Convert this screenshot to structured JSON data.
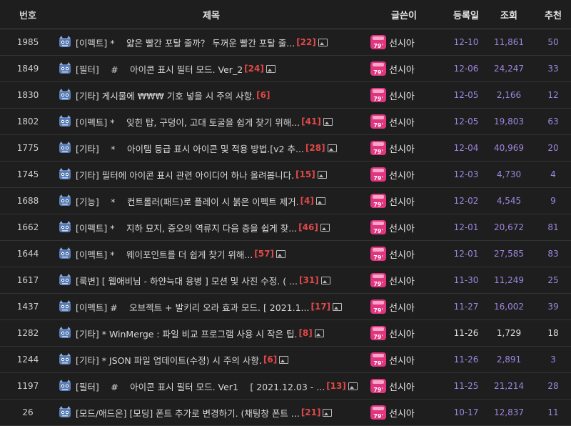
{
  "headers": {
    "no": "번호",
    "title": "제목",
    "writer": "글쓴이",
    "date": "등록일",
    "views": "조회",
    "rec": "추천"
  },
  "colors": {
    "date_purple": "#9d86e0",
    "comment_count": "#e04848",
    "badge": "#e0357f"
  },
  "badge_text": "79'",
  "rows": [
    {
      "no": "1985",
      "title": "[이펙트] * 　얇은 빨간 포탈 줄까？ 두꺼운 빨간 포탈 줄...",
      "comments": "[22]",
      "img": true,
      "writer": "선시아",
      "date": "12-10",
      "views": "11,861",
      "rec": "50",
      "date_style": "purple"
    },
    {
      "no": "1849",
      "title": "[필터] 　# 　아이콘 표시 필터 모드. Ver_2",
      "comments": "[24]",
      "img": true,
      "writer": "선시아",
      "date": "12-06",
      "views": "24,247",
      "rec": "33",
      "date_style": "purple"
    },
    {
      "no": "1830",
      "title": "[기타] 게시물에 ₩₩₩ 기호 넣을 시 주의 사항.",
      "comments": "[6]",
      "img": false,
      "writer": "선시아",
      "date": "12-05",
      "views": "2,166",
      "rec": "12",
      "date_style": "purple"
    },
    {
      "no": "1802",
      "title": "[이펙트] * 　잊힌 탑, 구덩이, 고대 토굴을 쉽게 찾기 위해...",
      "comments": "[41]",
      "img": true,
      "writer": "선시아",
      "date": "12-05",
      "views": "19,803",
      "rec": "63",
      "date_style": "purple"
    },
    {
      "no": "1775",
      "title": "[기타] 　* 　아이템 등급 표시 아이콘 및 적용 방법.[v2 추...",
      "comments": "[28]",
      "img": true,
      "writer": "선시아",
      "date": "12-04",
      "views": "40,969",
      "rec": "20",
      "date_style": "purple"
    },
    {
      "no": "1745",
      "title": "[기타] 필터에 아이콘 표시 관련 아이디어 하나 올려봅니다.",
      "comments": "[15]",
      "img": true,
      "writer": "선시아",
      "date": "12-03",
      "views": "4,730",
      "rec": "4",
      "date_style": "purple"
    },
    {
      "no": "1688",
      "title": "[기능] 　* 　컨트롤러(패드)로 플레이 시 붉은 이펙트 제거.",
      "comments": "[4]",
      "img": true,
      "writer": "선시아",
      "date": "12-02",
      "views": "4,545",
      "rec": "9",
      "date_style": "purple"
    },
    {
      "no": "1662",
      "title": "[이펙트] * 　지하 묘지, 증오의 역류지 다음 층을 쉽게 찾...",
      "comments": "[46]",
      "img": true,
      "writer": "선시아",
      "date": "12-01",
      "views": "20,672",
      "rec": "81",
      "date_style": "purple"
    },
    {
      "no": "1644",
      "title": "[이펙트] * 　웨이포인트를 더 쉽게 찾기 위해...",
      "comments": "[57]",
      "img": true,
      "writer": "선시아",
      "date": "12-01",
      "views": "27,585",
      "rec": "83",
      "date_style": "purple"
    },
    {
      "no": "1617",
      "title": "[룩변] [ 웹애비님 - 하얀늑대 용병 ] 모션 및 사진 수정. ( ...",
      "comments": "[31]",
      "img": true,
      "writer": "선시아",
      "date": "11-30",
      "views": "11,249",
      "rec": "25",
      "date_style": "purple"
    },
    {
      "no": "1437",
      "title": "[이펙트] # 　오브젝트 + 발키리 오라 효과 모드. [ 2021.1...",
      "comments": "[17]",
      "img": true,
      "writer": "선시아",
      "date": "11-27",
      "views": "16,002",
      "rec": "39",
      "date_style": "purple"
    },
    {
      "no": "1282",
      "title": "[기타] * WinMerge : 파일 비교 프로그램 사용 시 작은 팁.",
      "comments": "[8]",
      "img": true,
      "writer": "선시아",
      "date": "11-26",
      "views": "1,729",
      "rec": "18",
      "date_style": "white"
    },
    {
      "no": "1244",
      "title": "[기타] * JSON 파일 업데이트(수정) 시 주의 사항.",
      "comments": "[6]",
      "img": true,
      "writer": "선시아",
      "date": "11-26",
      "views": "2,891",
      "rec": "3",
      "date_style": "purple"
    },
    {
      "no": "1197",
      "title": "[필터] 　# 　아이콘 표시 필터 모드. Ver1 　[ 2021.12.03 - ...",
      "comments": "[13]",
      "img": true,
      "writer": "선시아",
      "date": "11-25",
      "views": "21,214",
      "rec": "28",
      "date_style": "purple"
    },
    {
      "no": "26",
      "title": "[모드/애드온] [모딩] 폰트 추가로 변경하기. (채팅창 폰트 ...",
      "comments": "[21]",
      "img": true,
      "writer": "선시아",
      "date": "10-17",
      "views": "12,837",
      "rec": "11",
      "date_style": "purple"
    }
  ]
}
